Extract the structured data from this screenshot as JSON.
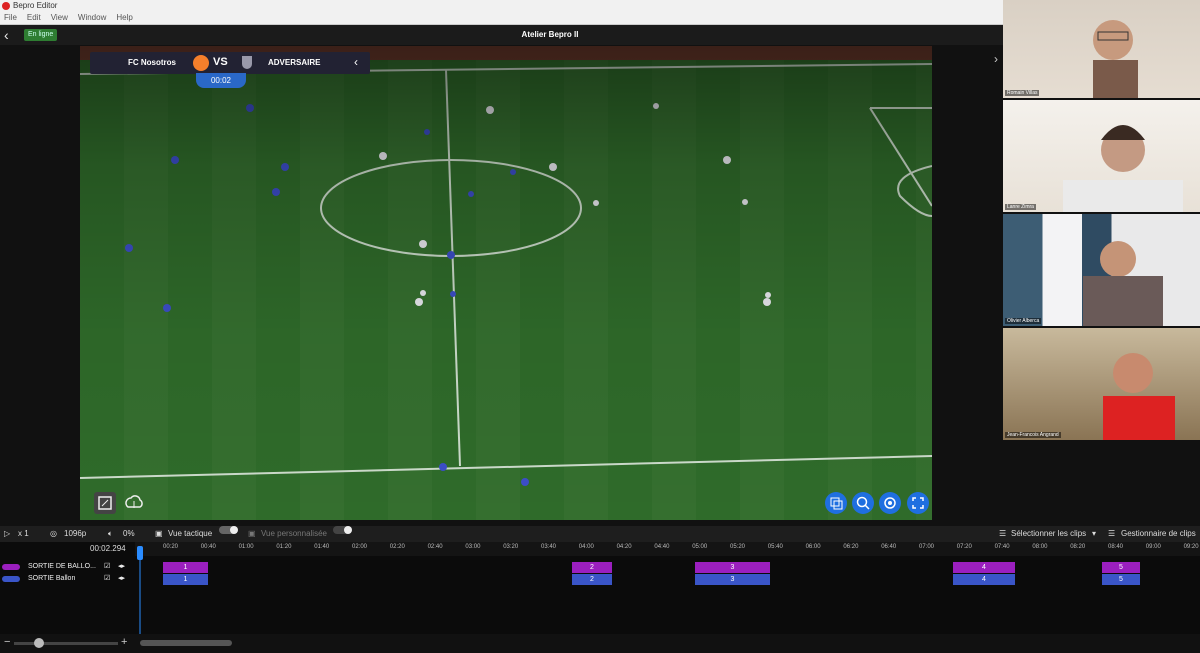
{
  "window": {
    "title": "Bepro Editor",
    "menu": [
      "File",
      "Edit",
      "View",
      "Window",
      "Help"
    ]
  },
  "header": {
    "status": "En ligne",
    "title": "Atelier Bepro II"
  },
  "scoreboard": {
    "home": "FC Nosotros",
    "vs": "VS",
    "away": "ADVERSAIRE",
    "clock": "00:02"
  },
  "participants": [
    "Romain Villas",
    "Lanre Zimra",
    "Olivier Alberca",
    "Jean-Francois Angrand"
  ],
  "toolbar": {
    "speed": "x 1",
    "quality": "1096p",
    "volume": "0%",
    "vue_tactique": "Vue tactique",
    "vue_perso": "Vue personnalisée",
    "select_clips": "Sélectionner les clips",
    "clip_manager": "Gestionnaire de clips"
  },
  "timeline": {
    "current_time": "00:02.294",
    "ticks": [
      "00:20",
      "00:40",
      "01:00",
      "01:20",
      "01:40",
      "02:00",
      "02:20",
      "02:40",
      "03:00",
      "03:20",
      "03:40",
      "04:00",
      "04:20",
      "04:40",
      "05:00",
      "05:20",
      "05:40",
      "06:00",
      "06:20",
      "06:40",
      "07:00",
      "07:20",
      "07:40",
      "08:00",
      "08:20",
      "08:40",
      "09:00",
      "09:20"
    ],
    "tracks": [
      {
        "name": "SORTIE DE BALLO...",
        "color": "#9b1fbf",
        "clips": [
          {
            "label": "1",
            "start": 163,
            "width": 45
          },
          {
            "label": "2",
            "start": 572,
            "width": 40
          },
          {
            "label": "3",
            "start": 695,
            "width": 75
          },
          {
            "label": "4",
            "start": 953,
            "width": 62
          },
          {
            "label": "5",
            "start": 1102,
            "width": 38
          }
        ]
      },
      {
        "name": "SORTIE Ballon",
        "color": "#3a55c8",
        "clips": [
          {
            "label": "1",
            "start": 163,
            "width": 45
          },
          {
            "label": "2",
            "start": 572,
            "width": 40
          },
          {
            "label": "3",
            "start": 695,
            "width": 75
          },
          {
            "label": "4",
            "start": 953,
            "width": 62
          },
          {
            "label": "5",
            "start": 1102,
            "width": 38
          }
        ]
      }
    ]
  }
}
